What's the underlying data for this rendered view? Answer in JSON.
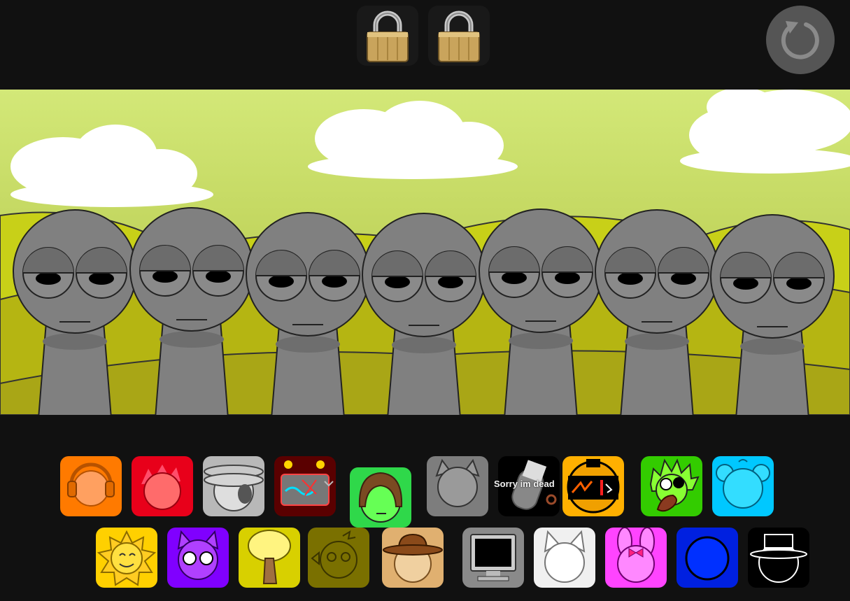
{
  "toolbar": {
    "lock_buttons": [
      {
        "icon": "padlock-icon",
        "state": "locked"
      },
      {
        "icon": "padlock-icon",
        "state": "locked"
      }
    ],
    "reset_icon": "reset-icon"
  },
  "stage": {
    "character_count": 7,
    "sky_color": "#cfe474",
    "hill_color": "#b8b816",
    "character_color": "#808080"
  },
  "tooltip": {
    "text": "Sorry im dead"
  },
  "palette": {
    "row1": [
      {
        "name": "orange-headphones",
        "color": "#ff7a00"
      },
      {
        "name": "red-spiky",
        "color": "#e8001a"
      },
      {
        "name": "gray-hat",
        "color": "#b8b8b8"
      },
      {
        "name": "dark-robot",
        "color": "#5a0000"
      },
      {
        "name": "green-hair",
        "color": "#2fd84a"
      },
      {
        "name": "gray-cat",
        "color": "#7d7d7d"
      },
      {
        "name": "black-dead",
        "color": "#000000"
      },
      {
        "name": "yellow-robot",
        "color": "#ffb000"
      },
      {
        "name": "green-spiky",
        "color": "#33cc00"
      },
      {
        "name": "cyan-bear",
        "color": "#00c8ff"
      }
    ],
    "row2": [
      {
        "name": "yellow-sun",
        "color": "#ffd000"
      },
      {
        "name": "purple-devil",
        "color": "#8000ff"
      },
      {
        "name": "yellow-tree",
        "color": "#d8d000"
      },
      {
        "name": "olive-robot",
        "color": "#7a7000"
      },
      {
        "name": "brown-hat",
        "color": "#e0b070"
      },
      {
        "name": "gray-computer",
        "color": "#8a8a8a"
      },
      {
        "name": "white-cat",
        "color": "#f0f0f0"
      },
      {
        "name": "pink-bunny",
        "color": "#ff44ff"
      },
      {
        "name": "blue-circle",
        "color": "#0020e0"
      },
      {
        "name": "black-tophat",
        "color": "#000000"
      }
    ]
  }
}
